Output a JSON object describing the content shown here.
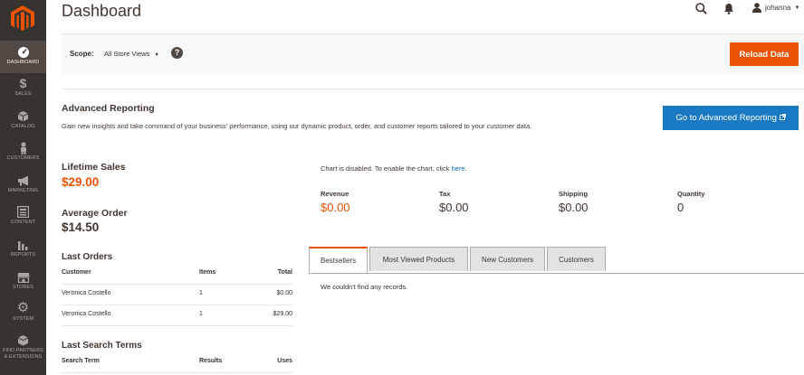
{
  "sidebar": {
    "items": [
      {
        "label": "Dashboard",
        "icon": "dashboard-gauge-icon"
      },
      {
        "label": "Sales",
        "icon": "dollar-icon"
      },
      {
        "label": "Catalog",
        "icon": "cube-icon"
      },
      {
        "label": "Customers",
        "icon": "person-icon"
      },
      {
        "label": "Marketing",
        "icon": "megaphone-icon"
      },
      {
        "label": "Content",
        "icon": "layout-icon"
      },
      {
        "label": "Reports",
        "icon": "bar-chart-icon"
      },
      {
        "label": "Stores",
        "icon": "store-icon"
      },
      {
        "label": "System",
        "icon": "gear-icon"
      },
      {
        "label_line1": "Find Partners",
        "label_line2": "& Extensions",
        "icon": "extension-box-icon"
      }
    ]
  },
  "header": {
    "title": "Dashboard",
    "user": "johanna"
  },
  "scope": {
    "label": "Scope:",
    "value": "All Store Views"
  },
  "reload_button": "Reload Data",
  "advanced_reporting": {
    "title": "Advanced Reporting",
    "description": "Gain new insights and take command of your business' performance, using our dynamic product, order, and customer reports tailored to your customer data.",
    "button": "Go to Advanced Reporting"
  },
  "lifetime_sales": {
    "label": "Lifetime Sales",
    "value": "$29.00"
  },
  "average_order": {
    "label": "Average Order",
    "value": "$14.50"
  },
  "last_orders": {
    "title": "Last Orders",
    "columns": [
      "Customer",
      "Items",
      "Total"
    ],
    "rows": [
      {
        "customer": "Veronica Costello",
        "items": "1",
        "total": "$0.00"
      },
      {
        "customer": "Veronica Costello",
        "items": "1",
        "total": "$29.00"
      }
    ]
  },
  "last_search_terms": {
    "title": "Last Search Terms",
    "columns": [
      "Search Term",
      "Results",
      "Uses"
    ]
  },
  "chart_notice": {
    "text": "Chart is disabled. To enable the chart, click ",
    "link": "here",
    "suffix": "."
  },
  "totals": [
    {
      "label": "Revenue",
      "value": "$0.00"
    },
    {
      "label": "Tax",
      "value": "$0.00"
    },
    {
      "label": "Shipping",
      "value": "$0.00"
    },
    {
      "label": "Quantity",
      "value": "0"
    }
  ],
  "tabs": [
    {
      "label": "Bestsellers",
      "active": true
    },
    {
      "label": "Most Viewed Products",
      "active": false
    },
    {
      "label": "New Customers",
      "active": false
    },
    {
      "label": "Customers",
      "active": false
    }
  ],
  "empty_message": "We couldn't find any records.",
  "colors": {
    "accent_orange": "#eb5202",
    "primary_blue": "#1979c3",
    "sidebar_bg": "#373330"
  }
}
